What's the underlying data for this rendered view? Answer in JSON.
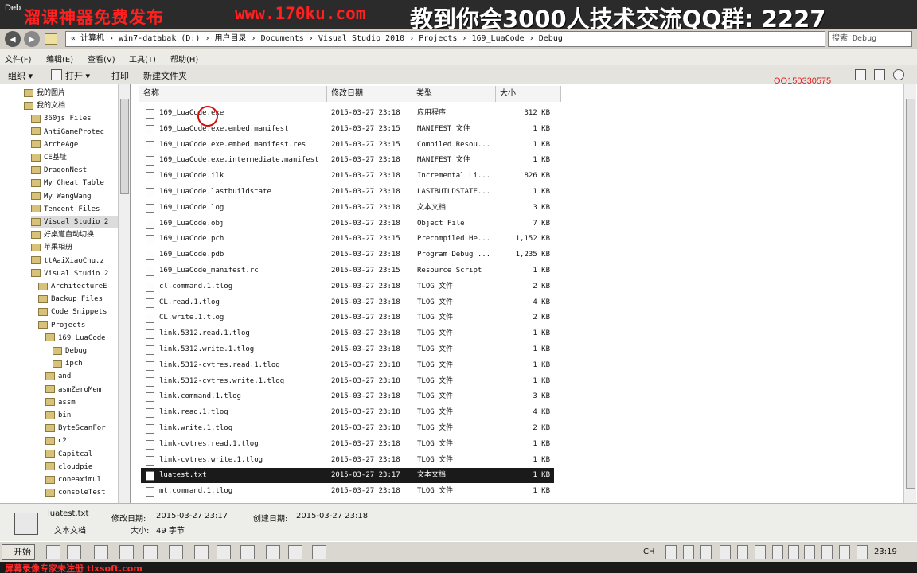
{
  "window": {
    "app_label": "Deb",
    "watermark_left": "溜课神器免费发布",
    "watermark_url": "www.170ku.com",
    "watermark_right": "教到你会3000人技术交流QQ群: 2227"
  },
  "address": {
    "path": "« 计算机 › win7-databak (D:) › 用户目录 › Documents › Visual Studio 2010 › Projects › 169_LuaCode › Debug",
    "search_placeholder": "搜索 Debug"
  },
  "menu": [
    "文件(F)",
    "编辑(E)",
    "查看(V)",
    "工具(T)",
    "帮助(H)"
  ],
  "toolbar": {
    "organize": "组织 ▾",
    "open": "打开 ▾",
    "print": "打印",
    "new_folder": "新建文件夹",
    "qq_overlay": "QQ150330575"
  },
  "nav_items": [
    {
      "label": "我的图片",
      "indent": 1
    },
    {
      "label": "我的文档",
      "indent": 1
    },
    {
      "label": "360js Files",
      "indent": 2
    },
    {
      "label": "AntiGameProtec",
      "indent": 2
    },
    {
      "label": "ArcheAge",
      "indent": 2
    },
    {
      "label": "CE基址",
      "indent": 2
    },
    {
      "label": "DragonNest",
      "indent": 2
    },
    {
      "label": "My Cheat Table",
      "indent": 2
    },
    {
      "label": "My WangWang",
      "indent": 2
    },
    {
      "label": "Tencent Files",
      "indent": 2
    },
    {
      "label": "Visual Studio 2",
      "indent": 2,
      "selected": true
    },
    {
      "label": "好桌道自动切换",
      "indent": 2
    },
    {
      "label": "苹果相册",
      "indent": 2
    },
    {
      "label": "ttAaiXiaoChu.z",
      "indent": 2
    },
    {
      "label": "Visual Studio 2",
      "indent": 2
    },
    {
      "label": "ArchitectureE",
      "indent": 3
    },
    {
      "label": "Backup Files",
      "indent": 3
    },
    {
      "label": "Code Snippets",
      "indent": 3
    },
    {
      "label": "Projects",
      "indent": 3
    },
    {
      "label": "169_LuaCode",
      "indent": 4
    },
    {
      "label": "Debug",
      "indent": 5
    },
    {
      "label": "ipch",
      "indent": 5
    },
    {
      "label": "and",
      "indent": 4
    },
    {
      "label": "asmZeroMem",
      "indent": 4
    },
    {
      "label": "assm",
      "indent": 4
    },
    {
      "label": "bin",
      "indent": 4
    },
    {
      "label": "ByteScanFor",
      "indent": 4
    },
    {
      "label": "c2",
      "indent": 4
    },
    {
      "label": "Capitcal",
      "indent": 4
    },
    {
      "label": "cloudpie",
      "indent": 4
    },
    {
      "label": "coneaximul",
      "indent": 4
    },
    {
      "label": "consoleTest",
      "indent": 4
    }
  ],
  "columns": [
    "名称",
    "修改日期",
    "类型",
    "大小"
  ],
  "files": [
    {
      "name": "169_LuaCode.exe",
      "date": "2015-03-27 23:18",
      "type": "应用程序",
      "size": "312 KB"
    },
    {
      "name": "169_LuaCode.exe.embed.manifest",
      "date": "2015-03-27 23:15",
      "type": "MANIFEST 文件",
      "size": "1 KB"
    },
    {
      "name": "169_LuaCode.exe.embed.manifest.res",
      "date": "2015-03-27 23:15",
      "type": "Compiled Resou...",
      "size": "1 KB"
    },
    {
      "name": "169_LuaCode.exe.intermediate.manifest",
      "date": "2015-03-27 23:18",
      "type": "MANIFEST 文件",
      "size": "1 KB"
    },
    {
      "name": "169_LuaCode.ilk",
      "date": "2015-03-27 23:18",
      "type": "Incremental Li...",
      "size": "826 KB"
    },
    {
      "name": "169_LuaCode.lastbuildstate",
      "date": "2015-03-27 23:18",
      "type": "LASTBUILDSTATE...",
      "size": "1 KB"
    },
    {
      "name": "169_LuaCode.log",
      "date": "2015-03-27 23:18",
      "type": "文本文档",
      "size": "3 KB"
    },
    {
      "name": "169_LuaCode.obj",
      "date": "2015-03-27 23:18",
      "type": "Object File",
      "size": "7 KB"
    },
    {
      "name": "169_LuaCode.pch",
      "date": "2015-03-27 23:15",
      "type": "Precompiled He...",
      "size": "1,152 KB"
    },
    {
      "name": "169_LuaCode.pdb",
      "date": "2015-03-27 23:18",
      "type": "Program Debug ...",
      "size": "1,235 KB"
    },
    {
      "name": "169_LuaCode_manifest.rc",
      "date": "2015-03-27 23:15",
      "type": "Resource Script",
      "size": "1 KB"
    },
    {
      "name": "cl.command.1.tlog",
      "date": "2015-03-27 23:18",
      "type": "TLOG 文件",
      "size": "2 KB"
    },
    {
      "name": "CL.read.1.tlog",
      "date": "2015-03-27 23:18",
      "type": "TLOG 文件",
      "size": "4 KB"
    },
    {
      "name": "CL.write.1.tlog",
      "date": "2015-03-27 23:18",
      "type": "TLOG 文件",
      "size": "2 KB"
    },
    {
      "name": "link.5312.read.1.tlog",
      "date": "2015-03-27 23:18",
      "type": "TLOG 文件",
      "size": "1 KB"
    },
    {
      "name": "link.5312.write.1.tlog",
      "date": "2015-03-27 23:18",
      "type": "TLOG 文件",
      "size": "1 KB"
    },
    {
      "name": "link.5312-cvtres.read.1.tlog",
      "date": "2015-03-27 23:18",
      "type": "TLOG 文件",
      "size": "1 KB"
    },
    {
      "name": "link.5312-cvtres.write.1.tlog",
      "date": "2015-03-27 23:18",
      "type": "TLOG 文件",
      "size": "1 KB"
    },
    {
      "name": "link.command.1.tlog",
      "date": "2015-03-27 23:18",
      "type": "TLOG 文件",
      "size": "3 KB"
    },
    {
      "name": "link.read.1.tlog",
      "date": "2015-03-27 23:18",
      "type": "TLOG 文件",
      "size": "4 KB"
    },
    {
      "name": "link.write.1.tlog",
      "date": "2015-03-27 23:18",
      "type": "TLOG 文件",
      "size": "2 KB"
    },
    {
      "name": "link-cvtres.read.1.tlog",
      "date": "2015-03-27 23:18",
      "type": "TLOG 文件",
      "size": "1 KB"
    },
    {
      "name": "link-cvtres.write.1.tlog",
      "date": "2015-03-27 23:18",
      "type": "TLOG 文件",
      "size": "1 KB"
    },
    {
      "name": "luatest.txt",
      "date": "2015-03-27 23:17",
      "type": "文本文档",
      "size": "1 KB",
      "selected": true
    },
    {
      "name": "mt.command.1.tlog",
      "date": "2015-03-27 23:18",
      "type": "TLOG 文件",
      "size": "1 KB"
    }
  ],
  "details": {
    "filename": "luatest.txt",
    "modified_label": "修改日期:",
    "modified_value": "2015-03-27 23:17",
    "created_label": "创建日期:",
    "created_value": "2015-03-27 23:18",
    "type": "文本文档",
    "size_label": "大小:",
    "size_value": "49 字节"
  },
  "taskbar": {
    "start": "开始",
    "lang": "CH",
    "clock": "23:19"
  },
  "bottom_watermark": "屏幕录像专家未注册 tlxsoft.com",
  "colors": {
    "title_bg": "#2b2b2b",
    "watermark_red": "#ff2020",
    "selection_bg": "#1a1a1a"
  }
}
